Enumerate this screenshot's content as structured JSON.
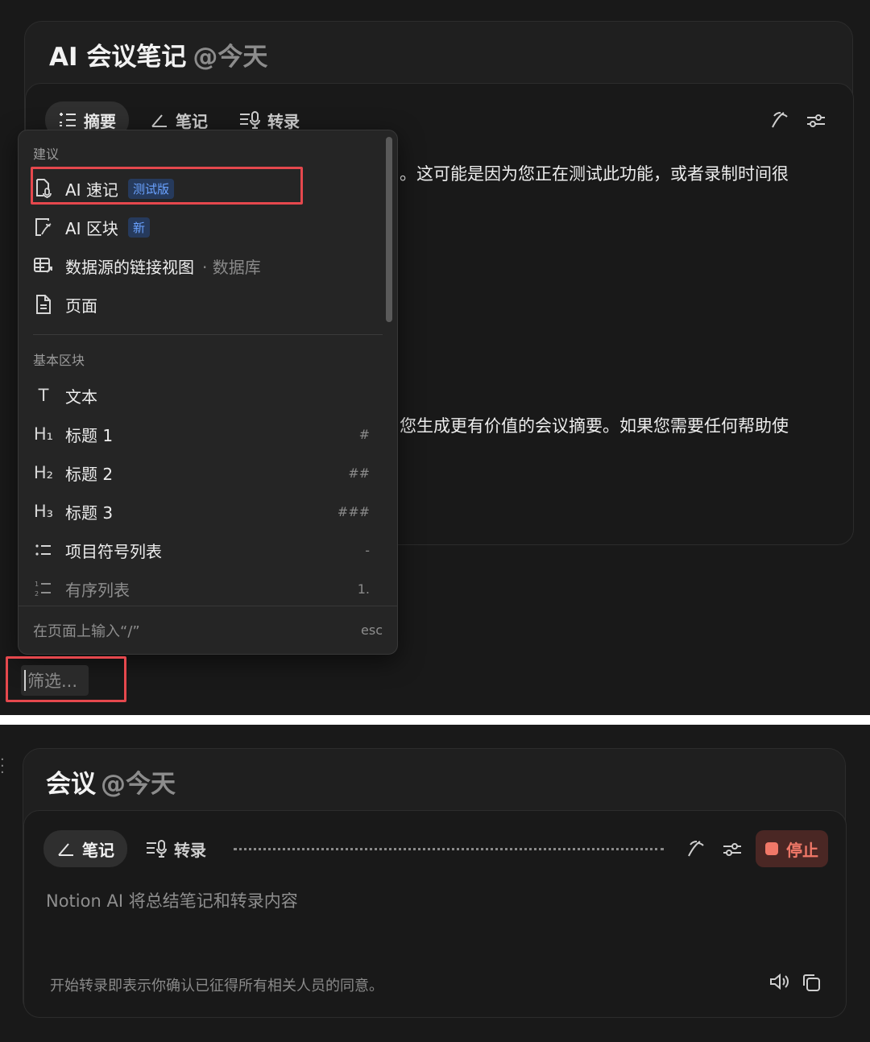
{
  "top": {
    "title": "AI 会议笔记",
    "date": "@今天",
    "tabs": [
      {
        "label": "摘要",
        "icon": "summary-list-icon",
        "active": true
      },
      {
        "label": "笔记",
        "icon": "pencil-icon",
        "active": false
      },
      {
        "label": "转录",
        "icon": "transcript-mic-icon",
        "active": false
      }
    ],
    "body_lines": [
      "。这可能是因为您正在测试此功能，或者录制时间很",
      "您生成更有价值的会议摘要。如果您需要任何帮助使"
    ]
  },
  "menu": {
    "section_suggest": "建议",
    "suggest_items": [
      {
        "label": "AI 速记",
        "badge": "测试版",
        "icon": "ai-memo-icon"
      },
      {
        "label": "AI 区块",
        "badge": "新",
        "icon": "ai-block-icon"
      },
      {
        "label": "数据源的链接视图",
        "suffix": "·  数据库",
        "icon": "linked-database-icon"
      },
      {
        "label": "页面",
        "icon": "page-icon"
      }
    ],
    "section_basic": "基本区块",
    "basic_items": [
      {
        "label": "文本",
        "icon_text": "T",
        "shortcut": ""
      },
      {
        "label": "标题 1",
        "icon_text": "H₁",
        "shortcut": "#"
      },
      {
        "label": "标题 2",
        "icon_text": "H₂",
        "shortcut": "##"
      },
      {
        "label": "标题 3",
        "icon_text": "H₃",
        "shortcut": "###"
      },
      {
        "label": "项目符号列表",
        "icon_text": "⁚☰",
        "shortcut": "-"
      },
      {
        "label": "有序列表",
        "icon_text": "⅟☰",
        "shortcut": "1."
      }
    ],
    "footer_hint": "在页面上输入“/”",
    "footer_esc": "esc"
  },
  "filter": {
    "placeholder": "筛选..."
  },
  "bottom": {
    "title": "会议",
    "date": "@今天",
    "tabs": [
      {
        "label": "笔记",
        "icon": "pencil-icon",
        "active": true
      },
      {
        "label": "转录",
        "icon": "transcript-mic-icon",
        "active": false
      }
    ],
    "stop_label": "停止",
    "placeholder": "Notion AI 将总结笔记和转录内容",
    "consent": "开始转录即表示你确认已征得所有相关人员的同意。"
  },
  "colors": {
    "accent_red": "#e5484d",
    "stop_text": "#f07868",
    "badge_blue": "#6aa2ff"
  }
}
